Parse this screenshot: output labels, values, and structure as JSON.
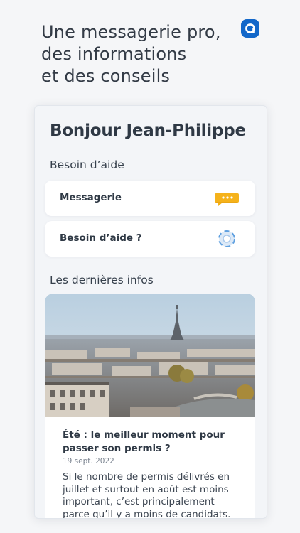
{
  "headline": {
    "line1": "Une messagerie pro,",
    "line2": "des informations",
    "line3": "et des conseils"
  },
  "logo": {
    "icon": "app-logo-icon",
    "color": "#1267c9"
  },
  "screen": {
    "greeting": "Bonjour Jean-Philippe",
    "help_section": {
      "title": "Besoin d’aide",
      "items": [
        {
          "label": "Messagerie",
          "icon": "chat-bubble-icon"
        },
        {
          "label": "Besoin d’aide ?",
          "icon": "lifebuoy-icon"
        }
      ]
    },
    "news_section": {
      "title": "Les dernières infos",
      "article": {
        "image": "paris-skyline-eiffel-tower-photo",
        "title": "Été : le meilleur moment pour passer son permis ?",
        "date": "19 sept. 2022",
        "excerpt": "Si le nombre de permis délivrés en juillet et surtout en août est moins important, c’est principalement parce qu’il y a moins de candidats. Alors, est-"
      }
    }
  },
  "colors": {
    "accent": "#1267c9",
    "chat_icon": "#f5b21b",
    "text": "#2f3945",
    "card_bg": "#ffffff",
    "screen_bg": "#f3f5f8"
  }
}
